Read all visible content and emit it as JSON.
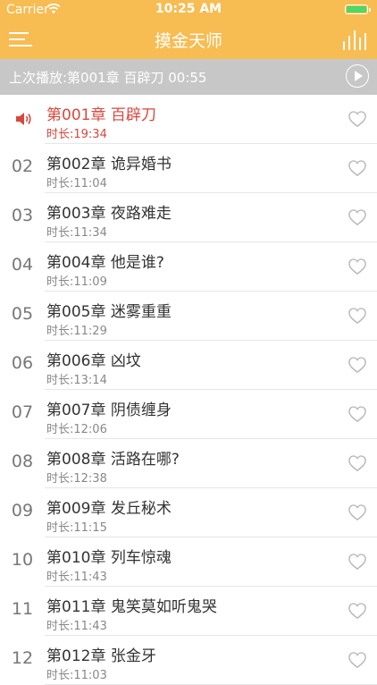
{
  "status_bar": {
    "carrier": "Carrier",
    "time": "10:25 AM"
  },
  "nav": {
    "title": "摸金天师"
  },
  "last_play": {
    "text": "上次播放:第001章 百辟刀 00:55"
  },
  "colors": {
    "header": "#f7bc52",
    "active": "#d9473c",
    "banner": "#c7c7c7"
  },
  "chapters": [
    {
      "num": "",
      "title": "第001章 百辟刀",
      "duration": "时长:19:34",
      "active": true
    },
    {
      "num": "02",
      "title": "第002章 诡异婚书",
      "duration": "时长:11:04"
    },
    {
      "num": "03",
      "title": "第003章 夜路难走",
      "duration": "时长:11:34"
    },
    {
      "num": "04",
      "title": "第004章 他是谁?",
      "duration": "时长:11:09"
    },
    {
      "num": "05",
      "title": "第005章 迷雾重重",
      "duration": "时长:11:29"
    },
    {
      "num": "06",
      "title": "第006章 凶坟",
      "duration": "时长:13:14"
    },
    {
      "num": "07",
      "title": "第007章 阴债缠身",
      "duration": "时长:12:06"
    },
    {
      "num": "08",
      "title": "第008章 活路在哪?",
      "duration": "时长:12:38"
    },
    {
      "num": "09",
      "title": "第009章 发丘秘术",
      "duration": "时长:11:15"
    },
    {
      "num": "10",
      "title": "第010章 列车惊魂",
      "duration": "时长:11:43"
    },
    {
      "num": "11",
      "title": "第011章 鬼笑莫如听鬼哭",
      "duration": "时长:11:43"
    },
    {
      "num": "12",
      "title": "第012章 张金牙",
      "duration": "时长:11:03"
    }
  ]
}
